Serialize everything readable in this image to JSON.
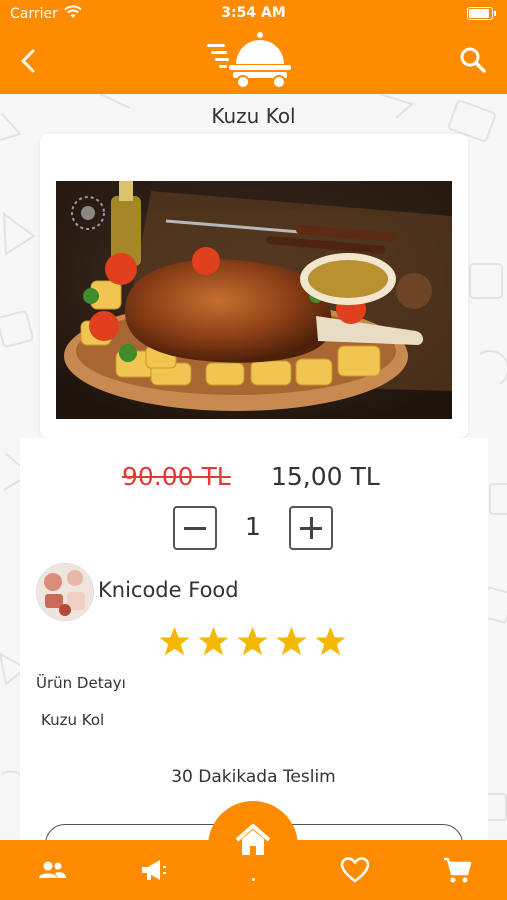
{
  "status_bar": {
    "carrier": "Carrier",
    "time": "3:54 AM"
  },
  "header": {
    "back_icon": "chevron-left-icon",
    "logo_icon": "food-delivery-cloche-icon",
    "search_icon": "search-icon"
  },
  "product": {
    "title": "Kuzu Kol",
    "old_price": "90.00 TL",
    "price": "15,00 TL",
    "quantity": "1",
    "rating": 5,
    "rating_max": 5
  },
  "store": {
    "name": "Knicode Food"
  },
  "details": {
    "label": "Ürün Detayı",
    "text": "Kuzu Kol",
    "delivery": "30 Dakikada Teslim"
  },
  "tabbar": {
    "items": [
      "users-icon",
      "megaphone-icon",
      "home-icon",
      "heart-icon",
      "cart-icon"
    ]
  },
  "colors": {
    "accent": "#ff8c00",
    "old_price": "#e53935",
    "star": "#f5b800"
  }
}
